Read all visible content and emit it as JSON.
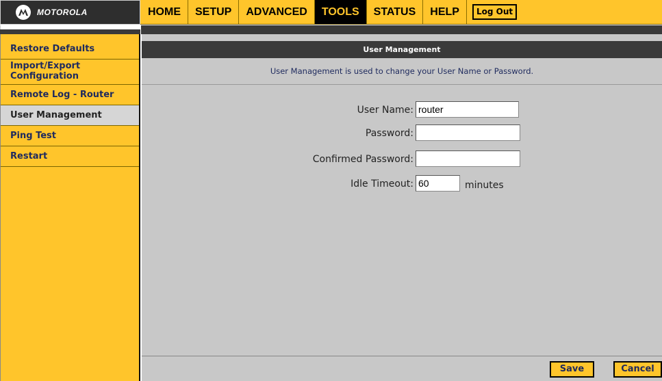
{
  "brand": {
    "logo_text": "MOTOROLA"
  },
  "nav": {
    "tabs": [
      {
        "label": "HOME"
      },
      {
        "label": "SETUP"
      },
      {
        "label": "ADVANCED"
      },
      {
        "label": "TOOLS",
        "active": true
      },
      {
        "label": "STATUS"
      },
      {
        "label": "HELP"
      }
    ],
    "logout_label": "Log Out"
  },
  "sidebar": {
    "items": [
      {
        "label": "Restore Defaults"
      },
      {
        "label": "Import/Export Configuration"
      },
      {
        "label": "Remote Log - Router"
      },
      {
        "label": "User Management",
        "active": true
      },
      {
        "label": "Ping Test"
      },
      {
        "label": "Restart"
      }
    ]
  },
  "main": {
    "title": "User Management",
    "description": "User Management is used to change your User Name or Password.",
    "form": {
      "username_label": "User Name:",
      "username_value": "router",
      "password_label": "Password:",
      "password_value": "",
      "confirm_label": "Confirmed Password:",
      "confirm_value": "",
      "idle_label": "Idle Timeout:",
      "idle_value": "60",
      "idle_unit": "minutes"
    },
    "buttons": {
      "save": "Save",
      "cancel": "Cancel"
    }
  },
  "colors": {
    "accent_yellow": "#ffc52b",
    "dark_bar": "#3a3a3a",
    "content_gray": "#c8c8c8",
    "sidebar_text": "#1e2a5e"
  }
}
